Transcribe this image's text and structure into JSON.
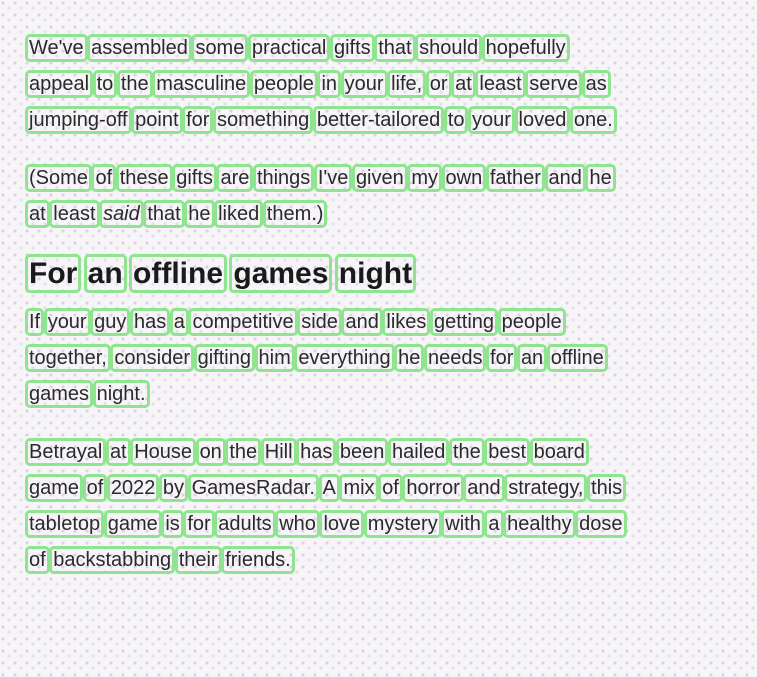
{
  "paragraphs": [
    "We've assembled some practical gifts that should hopefully appeal to the masculine people in your life, or at least serve as jumping-off point for something better-tailored to your loved one.",
    "(Some of these gifts are things I've given my own father and he at least",
    "said",
    "that he liked them.)"
  ],
  "heading": "For an offline games night",
  "paragraph3": "If your guy has a competitive side and likes getting people together, consider gifting him everything he needs for an offline games night.",
  "paragraph4": "Betrayal at House on the Hill has been hailed the best board game of 2022 by GamesRadar. A mix of horror and strategy, this tabletop game is for adults who love mystery with a healthy dose of backstabbing their friends."
}
